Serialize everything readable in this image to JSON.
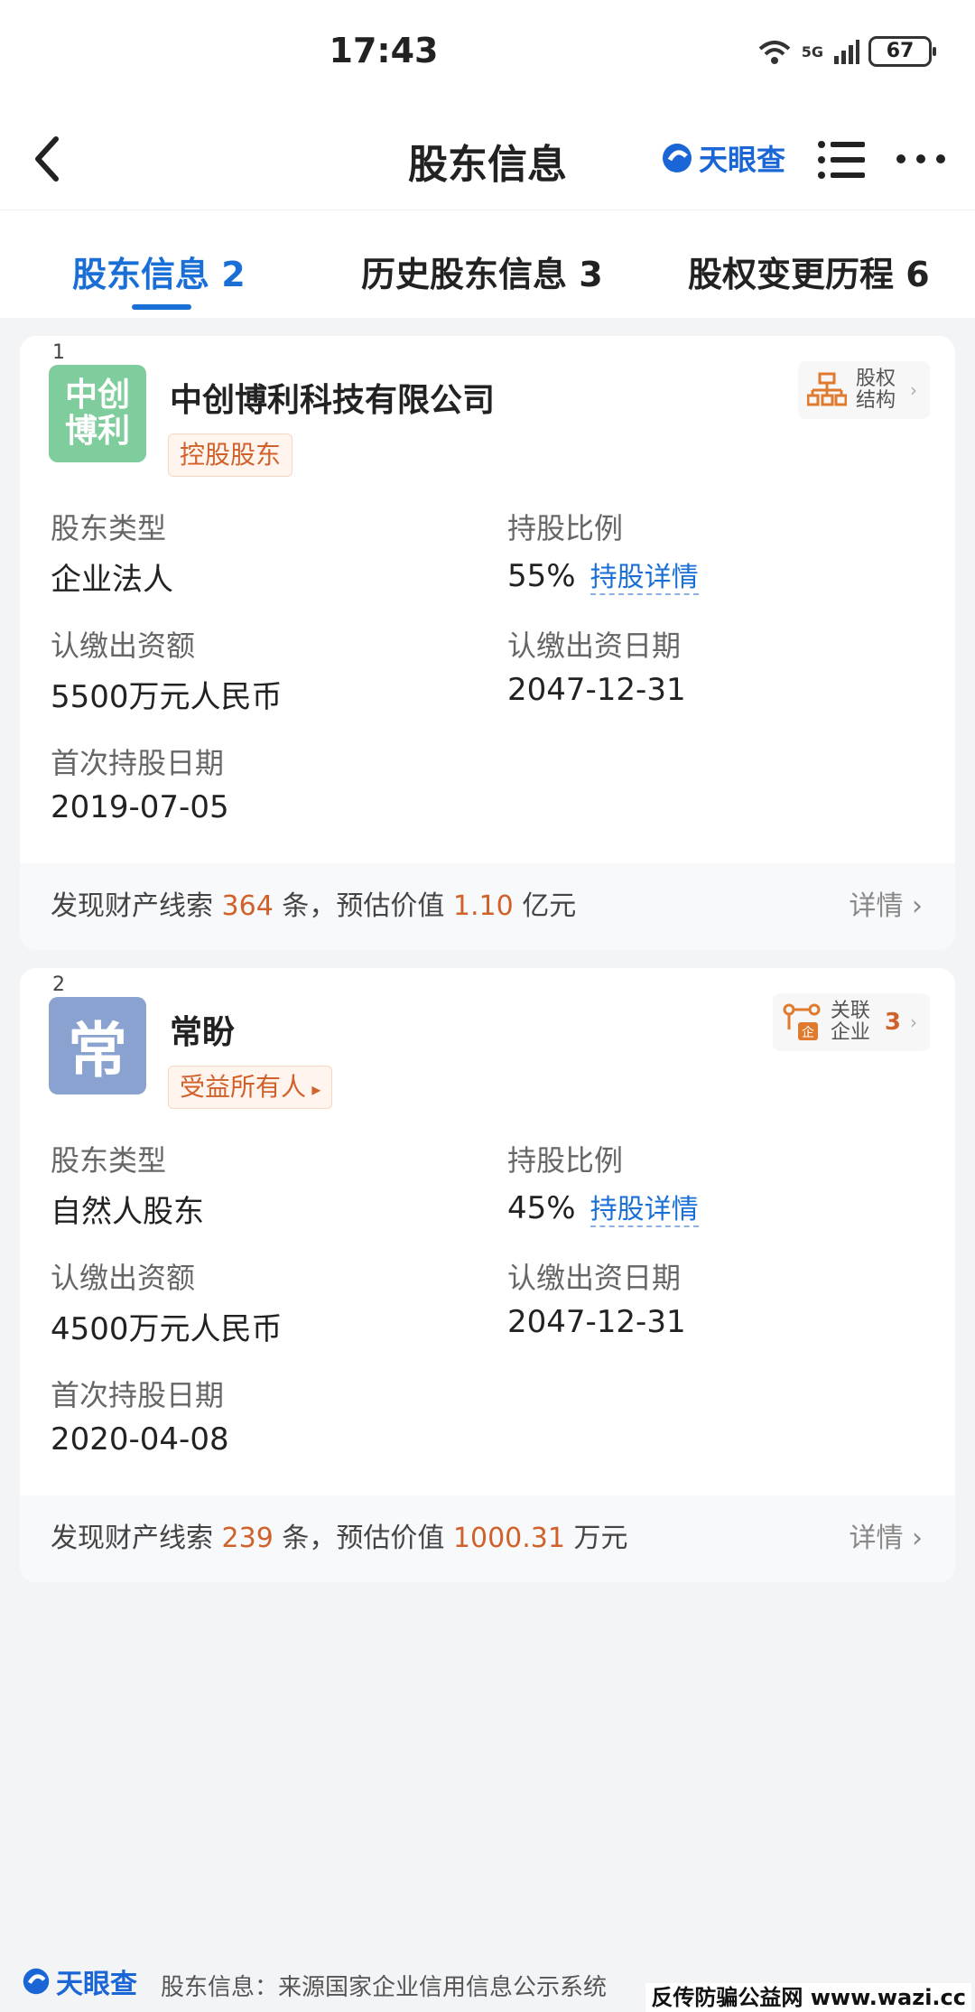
{
  "status_bar": {
    "time": "17:43",
    "network": "5G",
    "battery": "67"
  },
  "nav": {
    "title": "股东信息",
    "brand": "天眼查"
  },
  "tabs": [
    {
      "label": "股东信息 2",
      "active": true
    },
    {
      "label": "历史股东信息 3",
      "active": false
    },
    {
      "label": "股权变更历程 6",
      "active": false
    }
  ],
  "shareholders": [
    {
      "index": "1",
      "avatar_text": "中创博利",
      "name": "中创博利科技有限公司",
      "tag": "控股股东",
      "side_button": {
        "label": "股权结构",
        "count": ""
      },
      "type_label": "股东类型",
      "type_value": "企业法人",
      "ratio_label": "持股比例",
      "ratio_value": "55%",
      "ratio_link": "持股详情",
      "capital_label": "认缴出资额",
      "capital_value": "5500万元人民币",
      "capital_date_label": "认缴出资日期",
      "capital_date_value": "2047-12-31",
      "first_date_label": "首次持股日期",
      "first_date_value": "2019-07-05",
      "assets": {
        "prefix": "发现财产线索",
        "count": "364",
        "mid": "条，预估价值",
        "value": "1.10",
        "unit": "亿元",
        "more": "详情"
      }
    },
    {
      "index": "2",
      "avatar_text": "常",
      "name": "常盼",
      "tag": "受益所有人",
      "side_button": {
        "label": "关联企业",
        "count": "3"
      },
      "type_label": "股东类型",
      "type_value": "自然人股东",
      "ratio_label": "持股比例",
      "ratio_value": "45%",
      "ratio_link": "持股详情",
      "capital_label": "认缴出资额",
      "capital_value": "4500万元人民币",
      "capital_date_label": "认缴出资日期",
      "capital_date_value": "2047-12-31",
      "first_date_label": "首次持股日期",
      "first_date_value": "2020-04-08",
      "assets": {
        "prefix": "发现财产线索",
        "count": "239",
        "mid": "条，预估价值",
        "value": "1000.31",
        "unit": "万元",
        "more": "详情"
      }
    }
  ],
  "footer": {
    "brand": "天眼查",
    "source": "股东信息：来源国家企业信用信息公示系统",
    "watermark": "反传防骗公益网 www.wazi.cc"
  },
  "colors": {
    "accent": "#1a6fd6",
    "highlight": "#d0612a",
    "background": "#f3f4f6"
  }
}
